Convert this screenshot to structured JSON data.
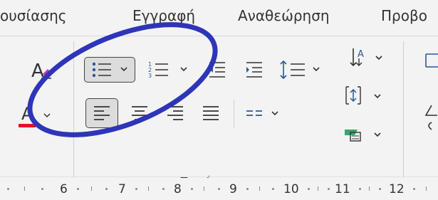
{
  "tabs": [
    {
      "label": "ουσίασης"
    },
    {
      "label": "Εγγραφή"
    },
    {
      "label": "Αναθεώρηση"
    },
    {
      "label": "Προβο"
    }
  ],
  "paragraph_group": {
    "label": "Παράγραφος",
    "bullets_button": {
      "icon": "bullets-icon",
      "selected": true
    },
    "numbering_button": {
      "icon": "numbering-icon"
    },
    "decrease_indent": {
      "icon": "decrease-indent-icon"
    },
    "increase_indent": {
      "icon": "increase-indent-icon"
    },
    "line_spacing": {
      "icon": "line-spacing-icon"
    },
    "sort_button": {
      "icon": "sort-icon",
      "glyph": "A"
    },
    "paragraph_spacing": {
      "icon": "paragraph-spacing-icon"
    },
    "shading_button": {
      "icon": "shading-icon"
    },
    "align_left": {
      "icon": "align-left-icon",
      "selected": true
    },
    "align_center": {
      "icon": "align-center-icon"
    },
    "align_right": {
      "icon": "align-right-icon"
    },
    "justify": {
      "icon": "justify-icon"
    },
    "columns": {
      "icon": "columns-icon"
    }
  },
  "font_group": {
    "clear_formatting": {
      "glyph": "A",
      "icon": "clear-formatting-icon"
    },
    "font_color": {
      "glyph": "A",
      "icon": "font-color-icon",
      "underline_color": "#e81123"
    }
  },
  "ruler": {
    "numbers": [
      "6",
      "7",
      "8",
      "9",
      "10",
      "11",
      "12"
    ]
  },
  "annotation": {
    "color": "#2e35b8"
  },
  "colors": {
    "accent": "#2e35b8",
    "selected_bg": "#dcdcdc",
    "icon_blue": "#2b579a",
    "shading_green": "#3aa56b"
  }
}
